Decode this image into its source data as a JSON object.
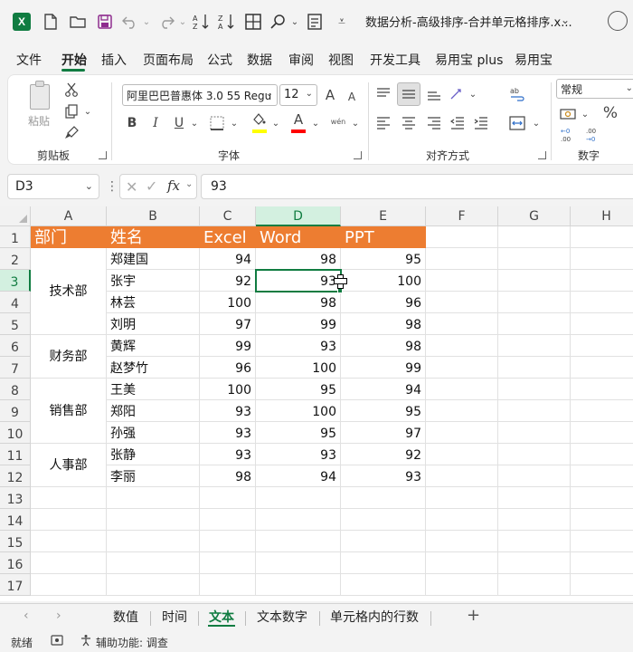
{
  "titlebar": {
    "filename": "数据分析-高级排序-合并单元格排序.x...",
    "icons": [
      "excel-logo",
      "new-file-icon",
      "open-folder-icon",
      "save-icon",
      "undo-icon",
      "redo-icon",
      "sort-az-icon",
      "sort-za-icon",
      "borders-icon",
      "find-icon",
      "form-icon",
      "customize-icon"
    ]
  },
  "app_logo": "X",
  "menu": {
    "tabs": [
      "文件",
      "开始",
      "插入",
      "页面布局",
      "公式",
      "数据",
      "审阅",
      "视图",
      "开发工具",
      "易用宝 plus",
      "易用宝"
    ],
    "active": "开始"
  },
  "ribbon": {
    "clipboard": {
      "paste_label": "粘贴",
      "group_label": "剪贴板"
    },
    "font": {
      "font_name": "阿里巴巴普惠体 3.0 55 Regu",
      "font_size": "12",
      "group_label": "字体",
      "bold": "B",
      "italic": "I",
      "underline": "U",
      "grow": "A",
      "shrink": "A",
      "font_color_glyph": "A",
      "fill_color": "#ffff00",
      "font_color": "#ff0000",
      "phonetic": "wén"
    },
    "alignment": {
      "group_label": "对齐方式"
    },
    "number": {
      "format": "常规",
      "group_label": "数字",
      "percent": "%"
    }
  },
  "formula_bar": {
    "name_box": "D3",
    "formula": "93",
    "fx": "fx"
  },
  "columns": [
    {
      "label": "A"
    },
    {
      "label": "B"
    },
    {
      "label": "C"
    },
    {
      "label": "D"
    },
    {
      "label": "E"
    },
    {
      "label": "F"
    },
    {
      "label": "G"
    },
    {
      "label": "H"
    }
  ],
  "rows": [
    "1",
    "2",
    "3",
    "4",
    "5",
    "6",
    "7",
    "8",
    "9",
    "10",
    "11",
    "12",
    "13",
    "14",
    "15",
    "16",
    "17"
  ],
  "table": {
    "headers": [
      "部门",
      "姓名",
      "Excel",
      "Word",
      "PPT"
    ],
    "departments": [
      "技术部",
      "财务部",
      "销售部",
      "人事部"
    ],
    "records": [
      {
        "name": "郑建国",
        "excel": "94",
        "word": "98",
        "ppt": "95"
      },
      {
        "name": "张宇",
        "excel": "92",
        "word": "93",
        "ppt": "100"
      },
      {
        "name": "林芸",
        "excel": "100",
        "word": "98",
        "ppt": "96"
      },
      {
        "name": "刘明",
        "excel": "97",
        "word": "99",
        "ppt": "98"
      },
      {
        "name": "黄辉",
        "excel": "99",
        "word": "93",
        "ppt": "98"
      },
      {
        "name": "赵梦竹",
        "excel": "96",
        "word": "100",
        "ppt": "99"
      },
      {
        "name": "王美",
        "excel": "100",
        "word": "95",
        "ppt": "94"
      },
      {
        "name": "郑阳",
        "excel": "93",
        "word": "100",
        "ppt": "95"
      },
      {
        "name": "孙强",
        "excel": "93",
        "word": "95",
        "ppt": "97"
      },
      {
        "name": "张静",
        "excel": "93",
        "word": "93",
        "ppt": "92"
      },
      {
        "name": "李丽",
        "excel": "98",
        "word": "94",
        "ppt": "93"
      }
    ],
    "header_color": "#ed7d31"
  },
  "sheets": {
    "tabs": [
      "数值",
      "时间",
      "文本",
      "文本数字",
      "单元格内的行数"
    ],
    "active": "文本",
    "add_label": "+"
  },
  "status": {
    "ready": "就绪",
    "accessibility": "辅助功能: 调查"
  },
  "accent": "#107c41"
}
